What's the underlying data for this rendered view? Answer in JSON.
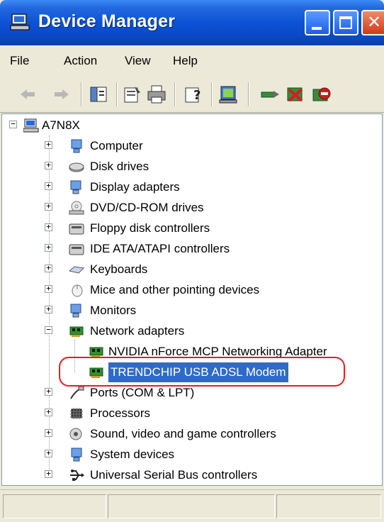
{
  "window": {
    "title": "Device Manager"
  },
  "menu": [
    {
      "label": "File"
    },
    {
      "label": "Action"
    },
    {
      "label": "View"
    },
    {
      "label": "Help"
    }
  ],
  "toolbar": {
    "icons": [
      "back-arrow-icon",
      "forward-arrow-icon",
      "show-hide-tree-icon",
      "properties-icon",
      "print-icon",
      "help-icon",
      "scan-hardware-icon",
      "update-driver-icon",
      "uninstall-icon",
      "disable-icon"
    ]
  },
  "tree": {
    "root": "A7N8X",
    "categories": [
      {
        "label": "Computer",
        "icon": "computer-icon"
      },
      {
        "label": "Disk drives",
        "icon": "disk-drive-icon"
      },
      {
        "label": "Display adapters",
        "icon": "display-adapter-icon"
      },
      {
        "label": "DVD/CD-ROM drives",
        "icon": "dvd-drive-icon"
      },
      {
        "label": "Floppy disk controllers",
        "icon": "floppy-controller-icon"
      },
      {
        "label": "IDE ATA/ATAPI controllers",
        "icon": "ide-controller-icon"
      },
      {
        "label": "Keyboards",
        "icon": "keyboard-icon"
      },
      {
        "label": "Mice and other pointing devices",
        "icon": "mouse-icon"
      },
      {
        "label": "Monitors",
        "icon": "monitor-icon"
      },
      {
        "label": "Network adapters",
        "icon": "network-adapter-icon",
        "expanded": true
      },
      {
        "label": "NVIDIA nForce MCP Networking Adapter",
        "icon": "network-card-icon",
        "child": true
      },
      {
        "label": "TRENDCHIP USB ADSL Modem",
        "icon": "network-card-icon",
        "child": true,
        "selected": true
      },
      {
        "label": "Ports (COM & LPT)",
        "icon": "port-icon"
      },
      {
        "label": "Processors",
        "icon": "processor-icon"
      },
      {
        "label": "Sound, video and game controllers",
        "icon": "sound-icon"
      },
      {
        "label": "System devices",
        "icon": "system-device-icon"
      },
      {
        "label": "Universal Serial Bus controllers",
        "icon": "usb-icon"
      }
    ]
  },
  "colors": {
    "titlebar": "#0c52d6",
    "selection": "#316ac5",
    "highlight_ring": "#e02020"
  }
}
